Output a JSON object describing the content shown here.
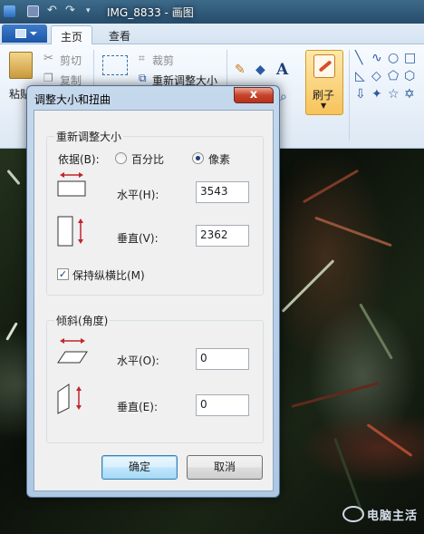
{
  "window": {
    "title": "IMG_8833 - 画图",
    "tabs": [
      "主页",
      "查看"
    ]
  },
  "ribbon": {
    "paste_label": "粘贴",
    "cut_label": "剪切",
    "copy_label": "复制",
    "crop_label": "裁剪",
    "resize_label": "重新调整大小",
    "brushes_label": "刷子"
  },
  "dialog": {
    "title": "调整大小和扭曲",
    "close_glyph": "x",
    "resize_group": {
      "title": "重新调整大小",
      "by_label": "依据(B):",
      "option_percent": "百分比",
      "option_pixels": "像素",
      "selected": "像素",
      "horizontal_label": "水平(H):",
      "horizontal_value": "3543",
      "vertical_label": "垂直(V):",
      "vertical_value": "2362",
      "keep_ratio_label": "保持纵横比(M)",
      "keep_ratio_checked": true
    },
    "skew_group": {
      "title": "倾斜(角度)",
      "horizontal_label": "水平(O):",
      "horizontal_value": "0",
      "vertical_label": "垂直(E):",
      "vertical_value": "0"
    },
    "ok_label": "确定",
    "cancel_label": "取消"
  },
  "watermark": {
    "text": "电脑主活"
  },
  "colors": {
    "accent": "#2c5aa0",
    "arrow": "#c0262c",
    "title_bar": "#264c6b"
  }
}
